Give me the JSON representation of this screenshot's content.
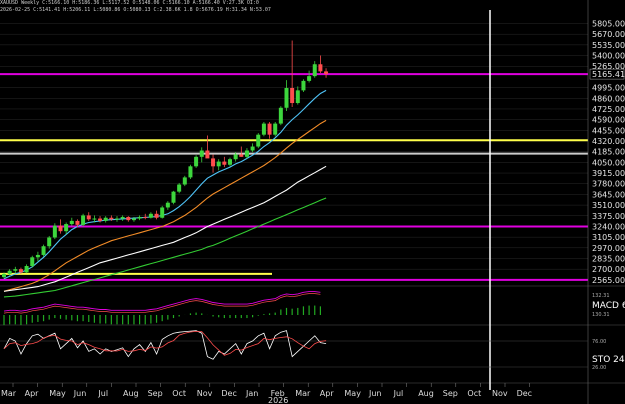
{
  "header": {
    "line1": "XAUUSD Weekly C:5166.10 H:5186.36 L:5117.52 O:5148.06 C:5166.10 A:5166.40 V:27.3K OI:0",
    "line2": "2026-02-25 C:5141.41 H:5206.11 L:5080.86 O:5080.13 C:2.38.6K 1.8 O:5676.19 H:31.34 N:53.07"
  },
  "colors": {
    "background": "#000000",
    "grid": "#2a2a2a",
    "up_candle": "#3dd63d",
    "down_candle": "#ff4d4d",
    "magenta": "#e000e0",
    "yellow": "#ffff4a",
    "white": "#ffffff",
    "cursor": "#ffffff"
  },
  "chart_data": [
    {
      "type": "candlestick",
      "y_axis_labels": [
        "5805.00",
        "5670.00",
        "5535.00",
        "5400.00",
        "5265.00",
        "5165.41",
        "4995.00",
        "4860.00",
        "4725.00",
        "4590.00",
        "4455.00",
        "4320.00",
        "4185.00",
        "4050.00",
        "3915.00",
        "3780.00",
        "3645.00",
        "3510.00",
        "3375.00",
        "3240.00",
        "3105.00",
        "2970.00",
        "2835.00",
        "2700.00",
        "2565.00"
      ],
      "y_values": [
        5805,
        5670,
        5535,
        5400,
        5265,
        5165.41,
        4995,
        4860,
        4725,
        4590,
        4455,
        4320,
        4185,
        4050,
        3915,
        3780,
        3645,
        3510,
        3375,
        3240,
        3105,
        2970,
        2835,
        2700,
        2565
      ],
      "price_range": [
        2500,
        5900
      ],
      "last_price": 5165.41,
      "candles": [
        [
          2600,
          2660,
          2580,
          2640
        ],
        [
          2640,
          2700,
          2620,
          2680
        ],
        [
          2680,
          2730,
          2650,
          2700
        ],
        [
          2700,
          2720,
          2640,
          2660
        ],
        [
          2660,
          2760,
          2650,
          2740
        ],
        [
          2740,
          2870,
          2720,
          2850
        ],
        [
          2850,
          2920,
          2800,
          2880
        ],
        [
          2880,
          3010,
          2860,
          2990
        ],
        [
          2990,
          3120,
          2960,
          3100
        ],
        [
          3100,
          3280,
          3080,
          3250
        ],
        [
          3250,
          3330,
          3150,
          3180
        ],
        [
          3180,
          3290,
          3140,
          3270
        ],
        [
          3270,
          3350,
          3250,
          3310
        ],
        [
          3310,
          3330,
          3230,
          3260
        ],
        [
          3260,
          3400,
          3240,
          3380
        ],
        [
          3380,
          3420,
          3310,
          3330
        ],
        [
          3330,
          3380,
          3290,
          3340
        ],
        [
          3340,
          3370,
          3290,
          3310
        ],
        [
          3310,
          3370,
          3290,
          3350
        ],
        [
          3350,
          3380,
          3310,
          3330
        ],
        [
          3330,
          3370,
          3300,
          3340
        ],
        [
          3340,
          3380,
          3310,
          3360
        ],
        [
          3360,
          3370,
          3300,
          3320
        ],
        [
          3320,
          3360,
          3300,
          3340
        ],
        [
          3340,
          3380,
          3320,
          3360
        ],
        [
          3360,
          3400,
          3330,
          3350
        ],
        [
          3350,
          3420,
          3340,
          3400
        ],
        [
          3400,
          3440,
          3330,
          3350
        ],
        [
          3350,
          3500,
          3340,
          3480
        ],
        [
          3480,
          3560,
          3450,
          3540
        ],
        [
          3540,
          3690,
          3520,
          3680
        ],
        [
          3680,
          3790,
          3660,
          3770
        ],
        [
          3770,
          3880,
          3750,
          3860
        ],
        [
          3860,
          4020,
          3840,
          4000
        ],
        [
          4000,
          4140,
          3980,
          4120
        ],
        [
          4120,
          4240,
          4050,
          4200
        ],
        [
          4200,
          4390,
          4120,
          4100
        ],
        [
          4100,
          4150,
          3920,
          4000
        ],
        [
          4000,
          4090,
          3950,
          4060
        ],
        [
          4060,
          4120,
          3990,
          4020
        ],
        [
          4020,
          4110,
          4000,
          4090
        ],
        [
          4090,
          4180,
          4060,
          4150
        ],
        [
          4150,
          4250,
          4120,
          4120
        ],
        [
          4120,
          4230,
          4100,
          4200
        ],
        [
          4200,
          4290,
          4180,
          4250
        ],
        [
          4250,
          4420,
          4230,
          4400
        ],
        [
          4400,
          4560,
          4380,
          4540
        ],
        [
          4540,
          4560,
          4350,
          4400
        ],
        [
          4400,
          4560,
          4380,
          4540
        ],
        [
          4540,
          4760,
          4520,
          4740
        ],
        [
          4740,
          5090,
          4700,
          4990
        ],
        [
          4990,
          5590,
          4750,
          4800
        ],
        [
          4800,
          5010,
          4780,
          4960
        ],
        [
          4960,
          5100,
          4940,
          5080
        ],
        [
          5080,
          5210,
          5060,
          5140
        ],
        [
          5140,
          5330,
          5120,
          5290
        ],
        [
          5290,
          5400,
          5180,
          5200
        ],
        [
          5200,
          5240,
          5120,
          5166
        ]
      ],
      "moving_averages": [
        {
          "color": "#4fc3f7",
          "values": [
            2580,
            2610,
            2640,
            2660,
            2690,
            2730,
            2790,
            2850,
            2920,
            3000,
            3080,
            3140,
            3200,
            3240,
            3270,
            3290,
            3300,
            3310,
            3320,
            3325,
            3330,
            3335,
            3340,
            3345,
            3350,
            3355,
            3360,
            3365,
            3380,
            3400,
            3440,
            3490,
            3550,
            3620,
            3700,
            3780,
            3850,
            3890,
            3930,
            3960,
            3990,
            4030,
            4060,
            4100,
            4140,
            4190,
            4250,
            4300,
            4360,
            4430,
            4520,
            4590,
            4650,
            4720,
            4790,
            4860,
            4920,
            4960
          ]
        },
        {
          "color": "#f28c28",
          "values": [
            2420,
            2440,
            2460,
            2480,
            2500,
            2520,
            2550,
            2590,
            2630,
            2680,
            2730,
            2780,
            2820,
            2860,
            2900,
            2940,
            2970,
            3000,
            3030,
            3060,
            3080,
            3100,
            3120,
            3140,
            3160,
            3180,
            3200,
            3220,
            3240,
            3270,
            3300,
            3340,
            3380,
            3430,
            3480,
            3540,
            3600,
            3650,
            3690,
            3730,
            3770,
            3810,
            3850,
            3890,
            3930,
            3970,
            4010,
            4060,
            4110,
            4170,
            4230,
            4290,
            4340,
            4390,
            4440,
            4490,
            4540,
            4580
          ]
        },
        {
          "color": "#ffffff",
          "values": [
            2420,
            2430,
            2440,
            2450,
            2460,
            2470,
            2480,
            2500,
            2520,
            2540,
            2570,
            2600,
            2630,
            2660,
            2690,
            2720,
            2750,
            2780,
            2800,
            2820,
            2840,
            2860,
            2880,
            2900,
            2920,
            2940,
            2960,
            2980,
            3000,
            3020,
            3040,
            3070,
            3100,
            3130,
            3160,
            3200,
            3240,
            3270,
            3300,
            3330,
            3360,
            3390,
            3420,
            3450,
            3480,
            3510,
            3540,
            3580,
            3620,
            3660,
            3700,
            3750,
            3800,
            3840,
            3880,
            3920,
            3960,
            4000
          ]
        },
        {
          "color": "#33cc33",
          "values": [
            2350,
            2355,
            2360,
            2370,
            2380,
            2390,
            2400,
            2410,
            2420,
            2430,
            2450,
            2470,
            2490,
            2510,
            2530,
            2550,
            2570,
            2590,
            2610,
            2630,
            2650,
            2670,
            2690,
            2710,
            2730,
            2750,
            2770,
            2790,
            2810,
            2830,
            2850,
            2870,
            2890,
            2910,
            2930,
            2950,
            2980,
            3000,
            3030,
            3060,
            3090,
            3120,
            3150,
            3180,
            3210,
            3240,
            3270,
            3300,
            3330,
            3360,
            3390,
            3420,
            3450,
            3480,
            3510,
            3540,
            3570,
            3600
          ]
        }
      ],
      "horizontal_lines": [
        {
          "price": 5165.41,
          "color": "#e000e0"
        },
        {
          "price": 4330,
          "color": "#ffff4a"
        },
        {
          "price": 4160,
          "color": "#cccccc"
        },
        {
          "price": 3240,
          "color": "#e000e0"
        },
        {
          "price": 2565,
          "color": "#e000e0"
        }
      ]
    },
    {
      "type": "line",
      "name": "MACD 6,",
      "label_text": "MACD 6,",
      "tick_labels": [
        "132.31",
        "130.31"
      ],
      "values": [
        5,
        6,
        6,
        5,
        6,
        8,
        9,
        10,
        12,
        14,
        13,
        12,
        11,
        10,
        10,
        9,
        8,
        7,
        7,
        6,
        6,
        6,
        6,
        6,
        6,
        6,
        7,
        8,
        10,
        12,
        14,
        16,
        18,
        20,
        21,
        20,
        18,
        16,
        15,
        14,
        14,
        14,
        14,
        14,
        15,
        17,
        19,
        20,
        21,
        25,
        27,
        26,
        27,
        29,
        30,
        30,
        29
      ]
    },
    {
      "type": "line",
      "name": "STO 24,",
      "label_text": "STO 24,",
      "tick_labels": [
        "76.00",
        "26.00"
      ],
      "values": [
        60,
        80,
        75,
        50,
        70,
        85,
        88,
        80,
        85,
        90,
        60,
        70,
        80,
        62,
        75,
        55,
        60,
        50,
        60,
        55,
        58,
        62,
        45,
        60,
        68,
        55,
        72,
        50,
        78,
        85,
        90,
        92,
        93,
        94,
        95,
        90,
        45,
        40,
        55,
        50,
        60,
        70,
        50,
        70,
        75,
        85,
        90,
        60,
        85,
        92,
        95,
        45,
        55,
        65,
        75,
        85,
        72,
        70
      ]
    }
  ],
  "x_axis": {
    "months": [
      "Mar",
      "Apr",
      "May",
      "Jun",
      "Jul",
      "Aug",
      "Sep",
      "Oct",
      "Nov",
      "Dec",
      "Jan",
      "Feb",
      "Mar",
      "Apr",
      "May",
      "Jun",
      "Jul",
      "Aug",
      "Sep",
      "Oct",
      "Nov",
      "Dec"
    ],
    "year_label": "2026"
  }
}
